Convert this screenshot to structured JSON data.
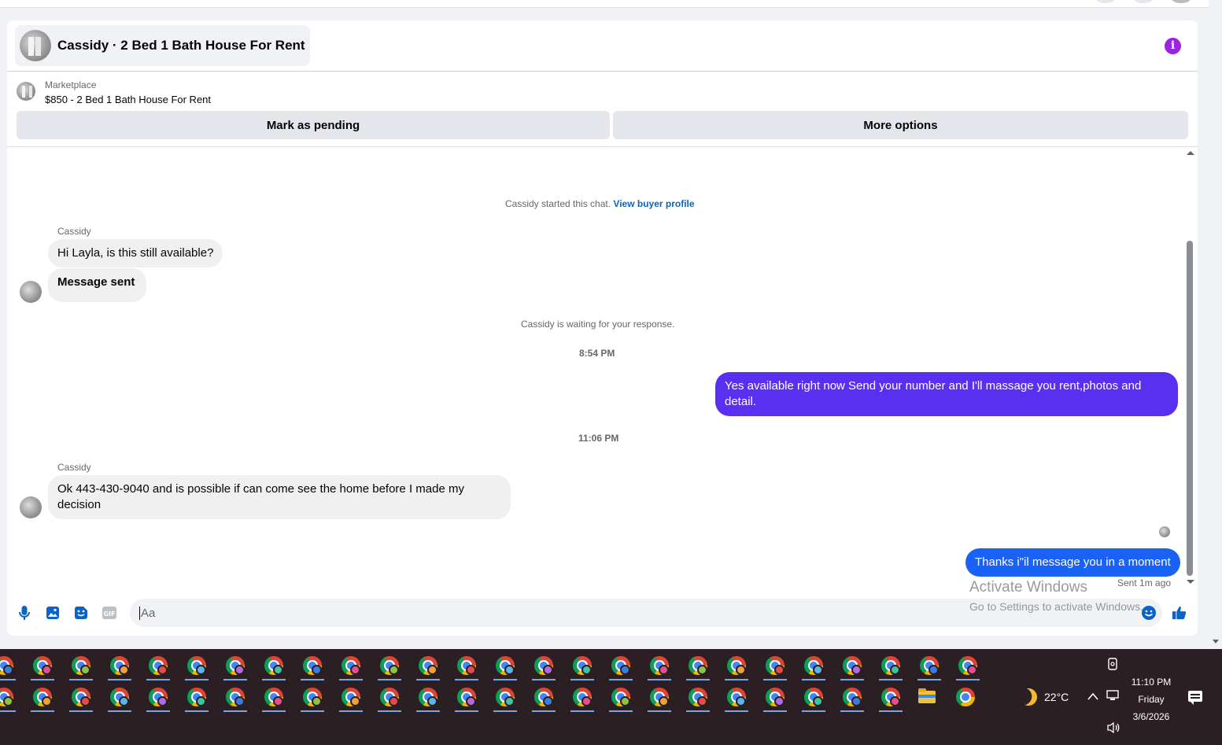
{
  "chat": {
    "title": "Cassidy · 2 Bed 1 Bath House For Rent",
    "marketplace_label": "Marketplace",
    "listing": "$850 - 2 Bed 1 Bath House For Rent",
    "mark_pending_label": "Mark as pending",
    "more_options_label": "More options"
  },
  "messages": {
    "started_text": "Cassidy started this chat.",
    "view_profile_link": "View buyer profile",
    "sender_1": "Cassidy",
    "msg_1": "Hi Layla, is this still available?",
    "msg_2": "Message sent",
    "waiting_text": "Cassidy is waiting for your response.",
    "time_1": "8:54 PM",
    "out_1": "Yes available right now Send your number and I'll massage you rent,photos and detail.",
    "time_2": "11:06 PM",
    "sender_2": "Cassidy",
    "msg_3": "Ok 443-430-9040 and is possible if can come see the home before I made my decision",
    "out_2": "Thanks i\"il message you in a moment",
    "sent_status": "Sent 1m ago"
  },
  "composer": {
    "placeholder": "Aa"
  },
  "watermark": {
    "title": "Activate Windows",
    "subtitle": "Go to Settings to activate Windows."
  },
  "colors": {
    "accent": "#0a64c8",
    "bubble_out_1": "#5b2fef",
    "bubble_out_2": "#1a62f5",
    "bubble_in": "#f0f0f0",
    "info_icon": "#9b24e0",
    "taskbar": "#2b1f24"
  },
  "icons": {
    "composer": [
      "microphone-icon",
      "image-icon",
      "sticker-icon",
      "gif-icon",
      "emoji-icon",
      "thumbs-up-icon"
    ],
    "taskbar_badge_colors": [
      "#3b7ddd",
      "#e3508e",
      "#8bc34a",
      "#f0a13a",
      "#e34c4c",
      "#59b7e8",
      "#b56be0",
      "#3ec4a0"
    ]
  },
  "taskbar": {
    "temperature": "22°C",
    "time": "11:10 PM",
    "day": "Friday",
    "date": "3/6/2026"
  }
}
